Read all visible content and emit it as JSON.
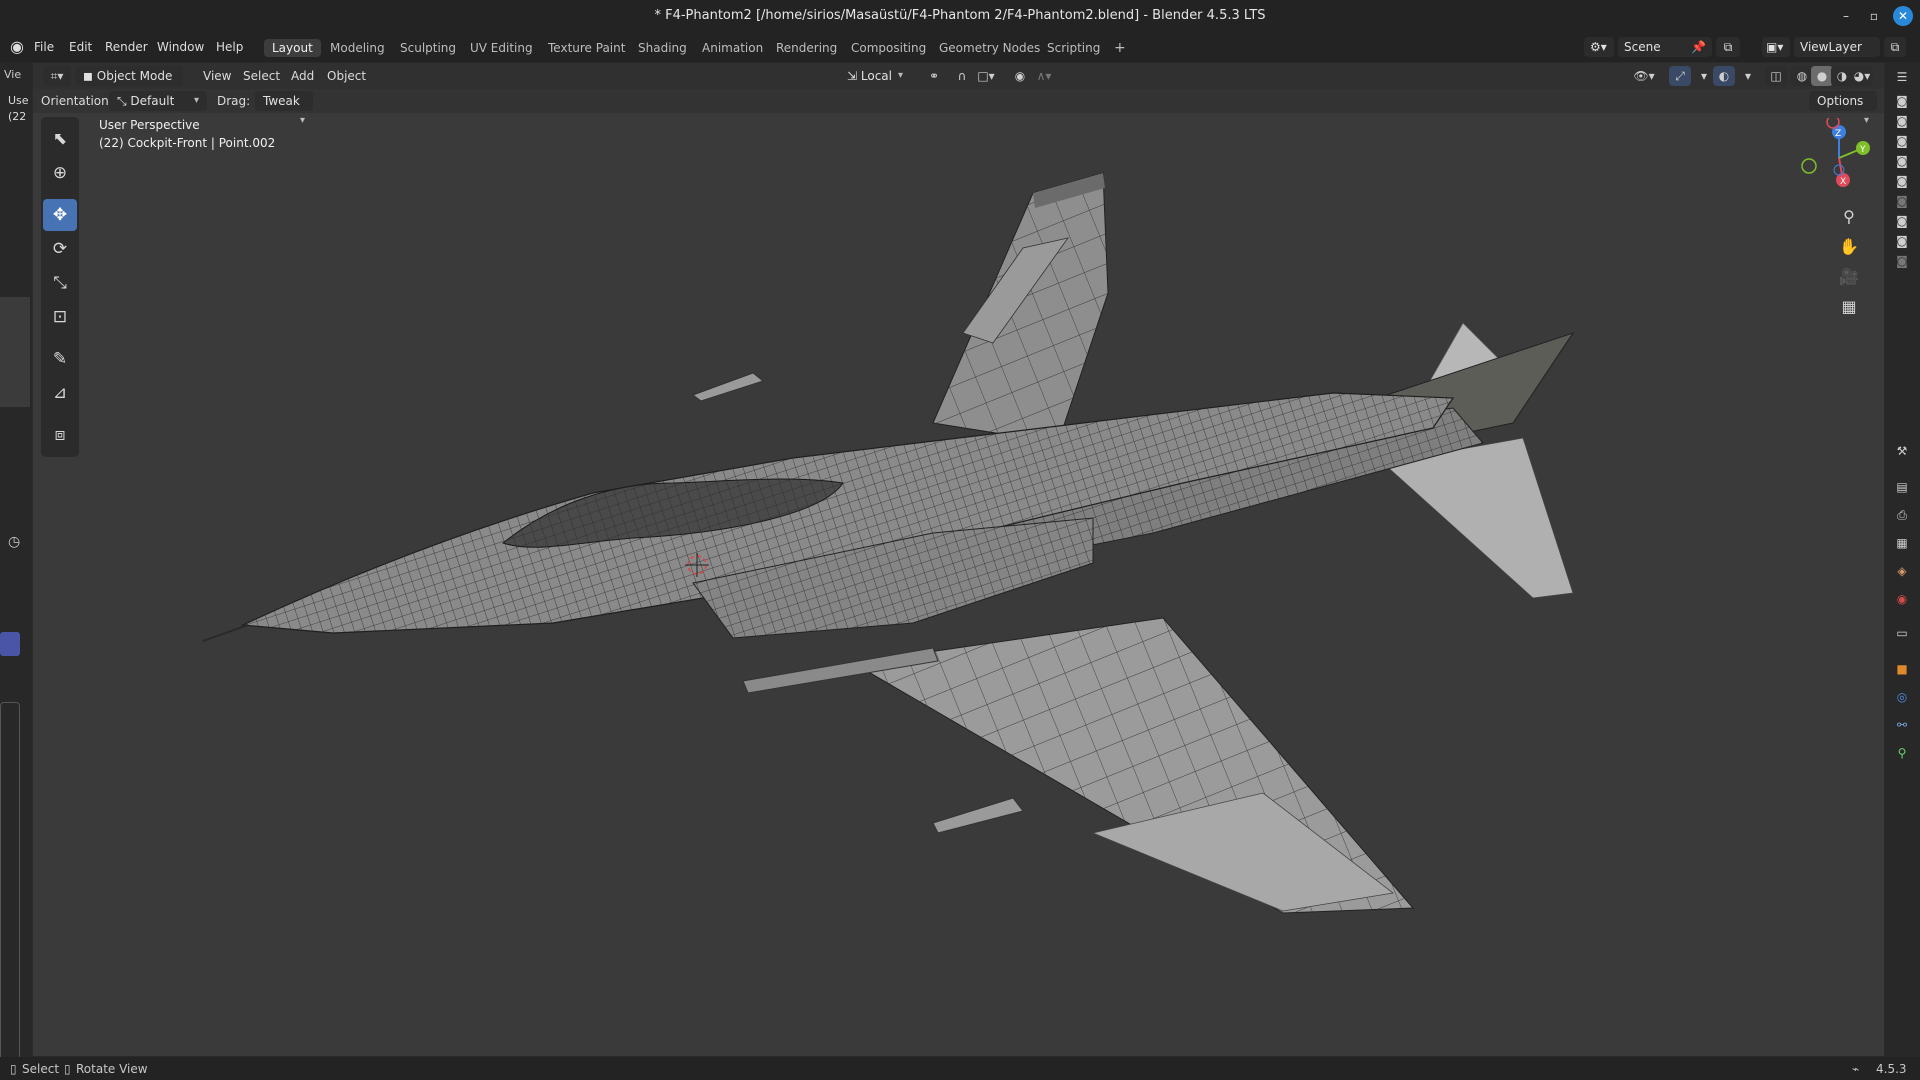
{
  "window": {
    "title": "* F4-Phantom2 [/home/sirios/Masaüstü/F4-Phantom 2/F4-Phantom2.blend] - Blender 4.5.3 LTS",
    "minimize": "–",
    "maximize": "▫",
    "close": "✕"
  },
  "menu": [
    "File",
    "Edit",
    "Render",
    "Window",
    "Help"
  ],
  "workspaces": [
    "Layout",
    "Modeling",
    "Sculpting",
    "UV Editing",
    "Texture Paint",
    "Shading",
    "Animation",
    "Rendering",
    "Compositing",
    "Geometry Nodes",
    "Scripting"
  ],
  "add_workspace": "+",
  "scene": {
    "label": "Scene"
  },
  "view_layer": {
    "label": "ViewLayer"
  },
  "viewport_header": {
    "editor_type_icon": "view3d-icon",
    "mode": "Object Mode",
    "menus": [
      "View",
      "Select",
      "Add",
      "Object"
    ],
    "transform_pivot": "Local",
    "left_cut_label": "Vie"
  },
  "tool_header": {
    "orientation_label": "Orientation:",
    "orientation_value": "Default",
    "drag_label": "Drag:",
    "drag_value": "Tweak",
    "options_label": "Options"
  },
  "viewport_overlay": {
    "view_name": "User Perspective",
    "object_info": "(22) Cockpit-Front | Point.002"
  },
  "left_strip": {
    "cut_text1": "Use",
    "cut_text2": "(22"
  },
  "toolbar": [
    {
      "name": "select-box-tool",
      "icon": "⬚",
      "active": false
    },
    {
      "name": "cursor-tool",
      "icon": "⊕",
      "active": false
    },
    {
      "name": "move-tool",
      "icon": "✥",
      "active": true
    },
    {
      "name": "rotate-tool",
      "icon": "⟳",
      "active": false
    },
    {
      "name": "scale-tool",
      "icon": "⤡",
      "active": false
    },
    {
      "name": "transform-tool",
      "icon": "⊡",
      "active": false
    },
    {
      "name": "annotate-tool",
      "icon": "✎",
      "active": false
    },
    {
      "name": "measure-tool",
      "icon": "📐",
      "active": false
    },
    {
      "name": "add-cube-tool",
      "icon": "⬛",
      "active": false
    }
  ],
  "gizmo": {
    "axes": [
      "Z",
      "Y",
      "X"
    ]
  },
  "statusbar": {
    "select": "Select",
    "rotate_view": "Rotate View",
    "version": "4.5.3"
  }
}
